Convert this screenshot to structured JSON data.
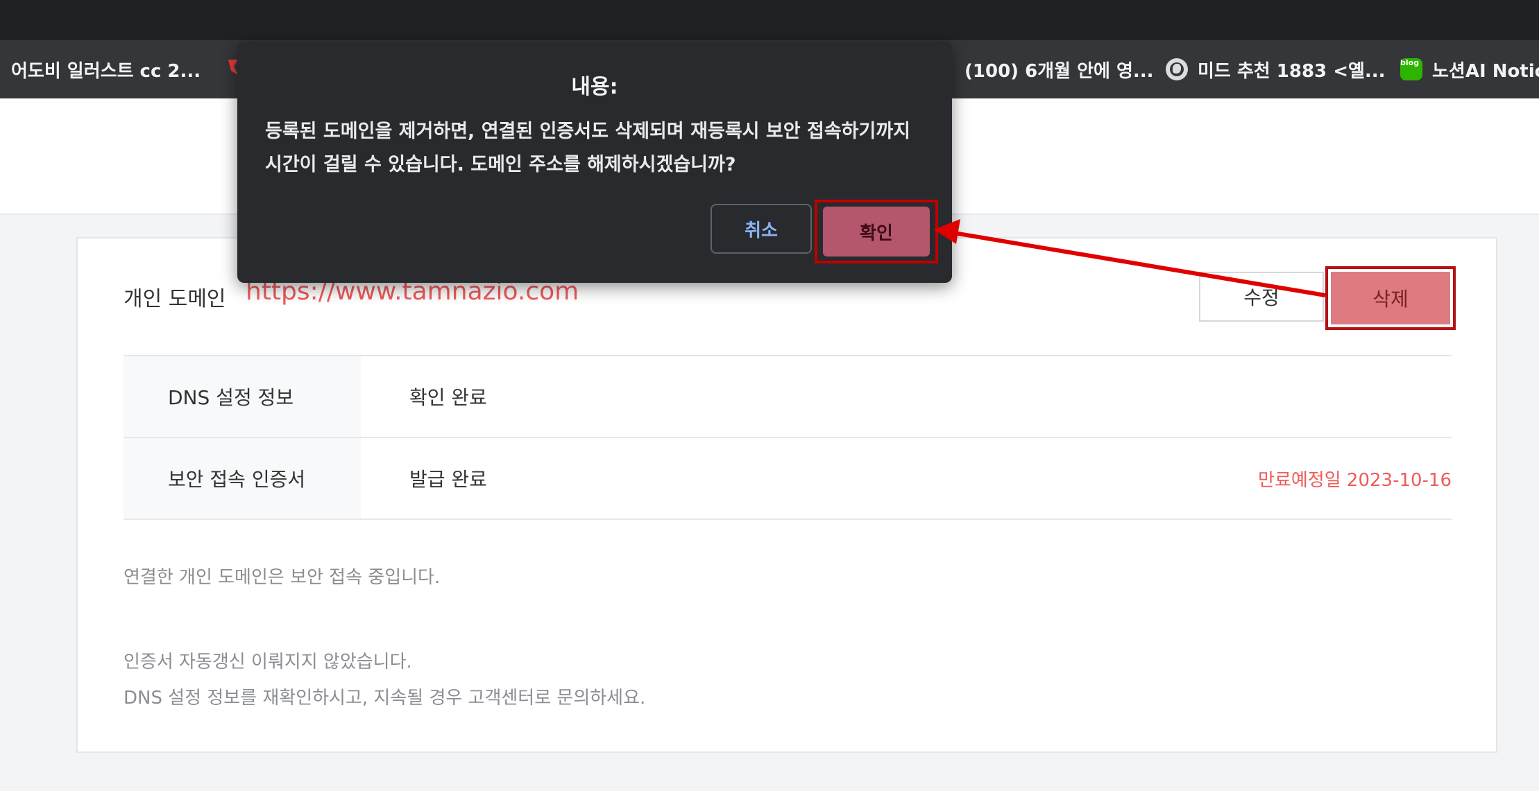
{
  "bookmarks": [
    {
      "label": "어도비 일러스트 cc 2..."
    },
    {
      "label": "(100) 6개월 안에 영..."
    },
    {
      "label": "미드 추천 1883 <옐..."
    },
    {
      "label": "노션AI Notic"
    }
  ],
  "domain": {
    "label": "개인 도메인",
    "url": "https://www.tamnazio.com",
    "edit_label": "수정",
    "delete_label": "삭제"
  },
  "table": {
    "rows": [
      {
        "header": "DNS 설정 정보",
        "value": "확인 완료",
        "extra": ""
      },
      {
        "header": "보안 접속 인증서",
        "value": "발급 완료",
        "extra": "만료예정일 2023-10-16"
      }
    ]
  },
  "notes": {
    "status": "연결한 개인 도메인은 보안 접속 중입니다.",
    "renewal_line1": "인증서 자동갱신 이뤄지지 않았습니다.",
    "renewal_line2": "DNS 설정 정보를 재확인하시고, 지속될 경우 고객센터로 문의하세요."
  },
  "dialog": {
    "title": "내용:",
    "message": "등록된 도메인을 제거하면, 연결된 인증서도 삭제되며 재등록시 보안 접속하기까지 시간이 걸릴 수 있습니다. 도메인 주소를 해제하시겠습니까?",
    "cancel_label": "취소",
    "confirm_label": "확인"
  },
  "colors": {
    "accent_red": "#ef5a5a",
    "annotation_red": "#e00000",
    "delete_fill": "#de7b80",
    "dialog_bg": "#292a2d"
  }
}
